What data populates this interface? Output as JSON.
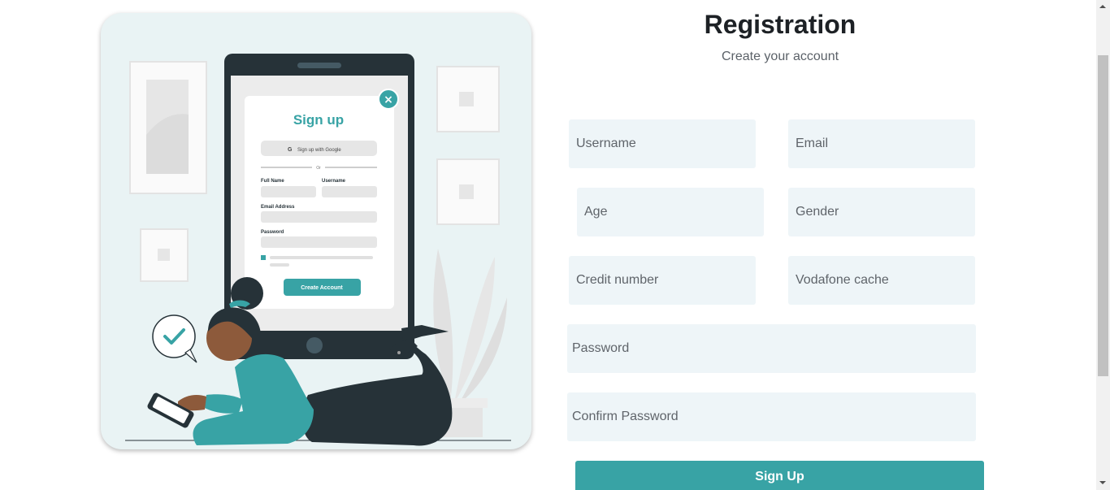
{
  "header": {
    "title": "Registration",
    "subtitle": "Create your account"
  },
  "form": {
    "username_placeholder": "Username",
    "email_placeholder": "Email",
    "age_placeholder": "Age",
    "gender_placeholder": "Gender",
    "credit_placeholder": "Credit number",
    "vodafone_placeholder": "Vodafone cache",
    "password_placeholder": "Password",
    "confirm_placeholder": "Confirm Password",
    "submit_label": "Sign Up"
  },
  "illustration": {
    "card_title": "Sign up",
    "google_label": "Sign up with Google",
    "divider_label": "Or",
    "full_name_label": "Full Name",
    "username_label": "Username",
    "email_label": "Email Address",
    "password_label": "Password",
    "create_account_label": "Create Account",
    "google_glyph": "G",
    "close_glyph": "×"
  },
  "colors": {
    "accent": "#38a3a5",
    "field_bg": "#eef5f8",
    "illustration_bg": "#e9f3f4",
    "dark": "#263238"
  },
  "icons": [
    "check-icon",
    "close-icon",
    "google-icon",
    "scroll-up-icon",
    "scroll-down-icon"
  ]
}
